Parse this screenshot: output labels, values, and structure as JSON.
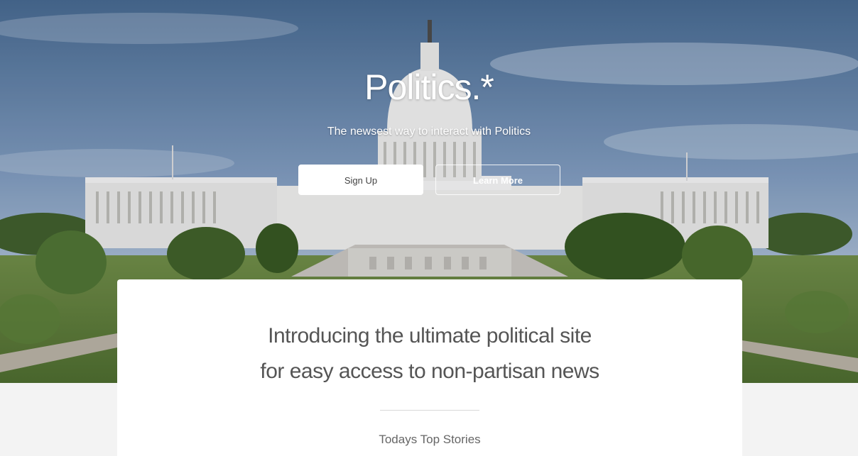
{
  "hero": {
    "title": "Politics.*",
    "subtitle": "The newsest way to interact with Politics",
    "signup_label": "Sign Up",
    "learn_more_label": "Learn More",
    "background_image": "us-capitol-building-photo"
  },
  "main": {
    "intro_line1": "Introducing the ultimate political site",
    "intro_line2": "for easy access to non-partisan news",
    "section_title": "Todays Top Stories"
  },
  "colors": {
    "page_background": "#f3f3f3",
    "card_background": "#ffffff",
    "text": "#555555"
  }
}
